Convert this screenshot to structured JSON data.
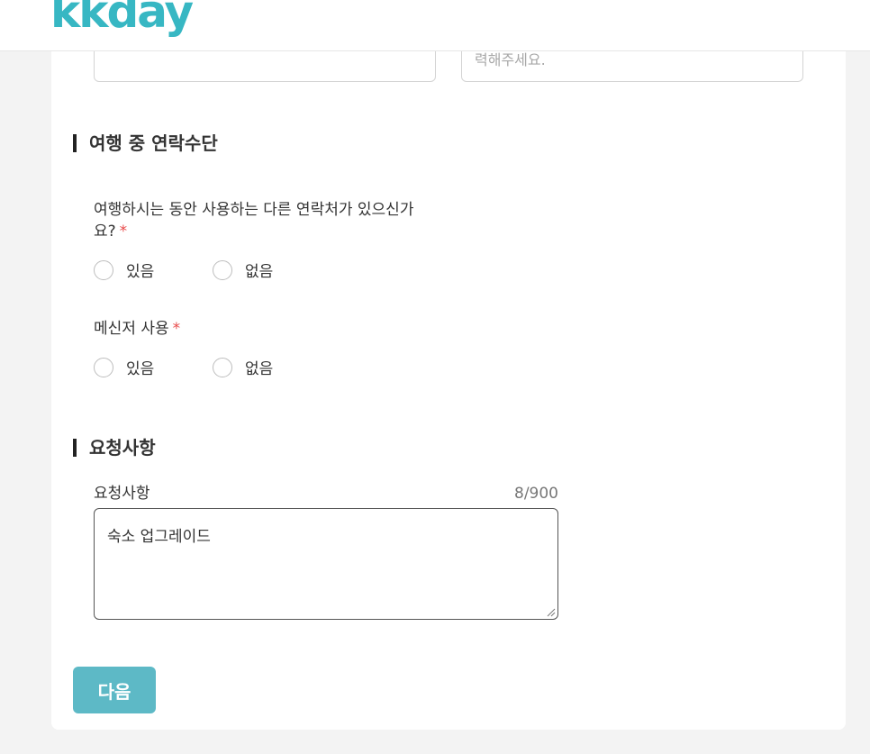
{
  "header": {
    "logo_text": "kkday"
  },
  "prev_inputs": {
    "right_placeholder": "력해주세요."
  },
  "section_contact": {
    "title": "여행 중 연락수단",
    "question1_line1": "여행하시는 동안 사용하는 다른 연락처가 있으신가",
    "question1_line2": "요?",
    "required_mark": "*",
    "options1": [
      "있음",
      "없음"
    ],
    "question2": "메신저 사용",
    "options2": [
      "있음",
      "없음"
    ]
  },
  "section_request": {
    "title": "요청사항",
    "label": "요청사항",
    "counter": "8/900",
    "textarea_value": "숙소 업그레이드"
  },
  "footer": {
    "next_label": "다음"
  },
  "colors": {
    "brand": "#37b7c3",
    "button": "#5db9c6",
    "required": "#e84a4a"
  }
}
